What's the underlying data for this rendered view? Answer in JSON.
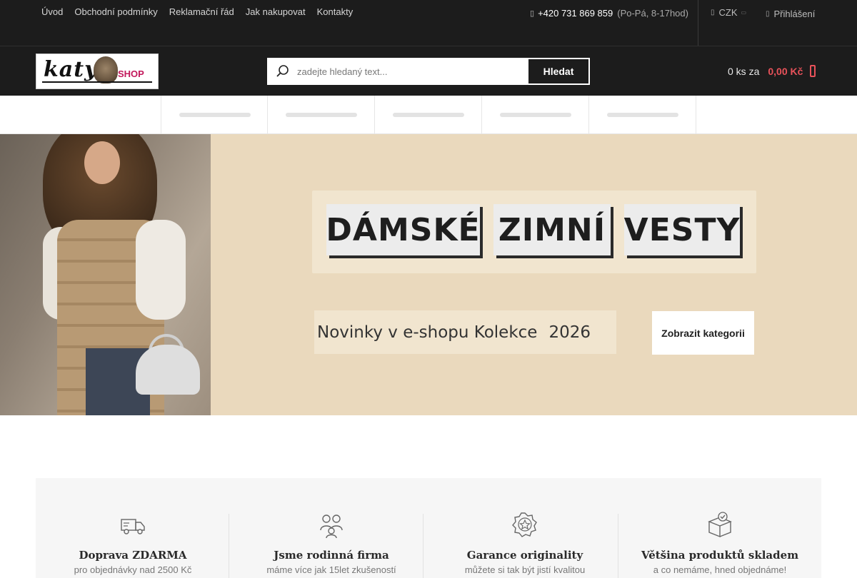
{
  "topbar": {
    "links": [
      "Úvod",
      "Obchodní podmínky",
      "Reklamační řád",
      "Jak nakupovat",
      "Kontakty"
    ],
    "phone_icon": "phone-icon",
    "phone": "+420 731 869 859",
    "hours": "(Po-Pá, 8-17hod)",
    "currency": "CZK",
    "login": "Přihlášení"
  },
  "header": {
    "logo_text": "katy",
    "logo_shop": "SHOP",
    "search_placeholder": "zadejte hledaný text...",
    "search_button": "Hledat",
    "cart_count": "0 ks za",
    "cart_price": "0,00 Kč"
  },
  "banner": {
    "title_words": [
      "DÁMSKÉ",
      "ZIMNÍ",
      "VESTY"
    ],
    "subtitle": "Novinky v e-shopu  Kolekce",
    "year": "2026",
    "cta": "Zobrazit kategorii"
  },
  "benefits": [
    {
      "icon": "truck-icon",
      "title": "Doprava ZDARMA",
      "sub": "pro objednávky nad 2500 Kč"
    },
    {
      "icon": "family-icon",
      "title": "Jsme rodinná firma",
      "sub": "máme více jak 15let zkušeností"
    },
    {
      "icon": "badge-star-icon",
      "title": "Garance originality",
      "sub": "můžete si tak být jistí kvalitou"
    },
    {
      "icon": "box-check-icon",
      "title": "Většina produktů skladem",
      "sub": "a co nemáme, hned objednáme!"
    }
  ],
  "colors": {
    "dark": "#1c1c1c",
    "accent": "#e8525a",
    "banner_bg": "#ead9bd"
  }
}
